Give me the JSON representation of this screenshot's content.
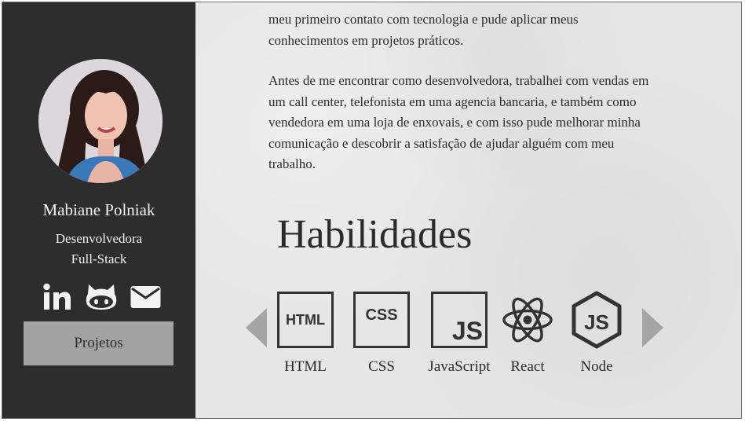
{
  "profile": {
    "name": "Mabiane Polniak",
    "role_line1": "Desenvolvedora",
    "role_line2": "Full-Stack"
  },
  "social": {
    "icons": [
      "linkedin-icon",
      "github-icon",
      "mail-icon"
    ]
  },
  "sidebar": {
    "projects_button": "Projetos"
  },
  "about": {
    "paragraph1_line1": "meu primeiro contato com tecnologia e pude aplicar meus",
    "paragraph1_line2": "conhecimentos em projetos práticos.",
    "paragraph2": "Antes de me encontrar como desenvolvedora, trabalhei com vendas em um call center, telefonista em uma agencia bancaria, e também como vendedora em uma loja de enxovais, e com isso pude melhorar minha comunicação e descobrir a satisfação de ajudar alguém com meu trabalho."
  },
  "skills": {
    "title": "Habilidades",
    "items": [
      {
        "label": "HTML",
        "badge": "HTML",
        "icon": "html-icon"
      },
      {
        "label": "CSS",
        "badge": "CSS",
        "icon": "css-icon"
      },
      {
        "label": "JavaScript",
        "badge": "JS",
        "icon": "javascript-icon"
      },
      {
        "label": "React",
        "icon": "react-icon"
      },
      {
        "label": "Node",
        "badge": "JS",
        "icon": "node-icon"
      }
    ]
  },
  "colors": {
    "sidebar": "#2d2d2d",
    "button": "#a3a3a3",
    "paper": "#e6e6e4",
    "text": "#2b2b2b"
  }
}
